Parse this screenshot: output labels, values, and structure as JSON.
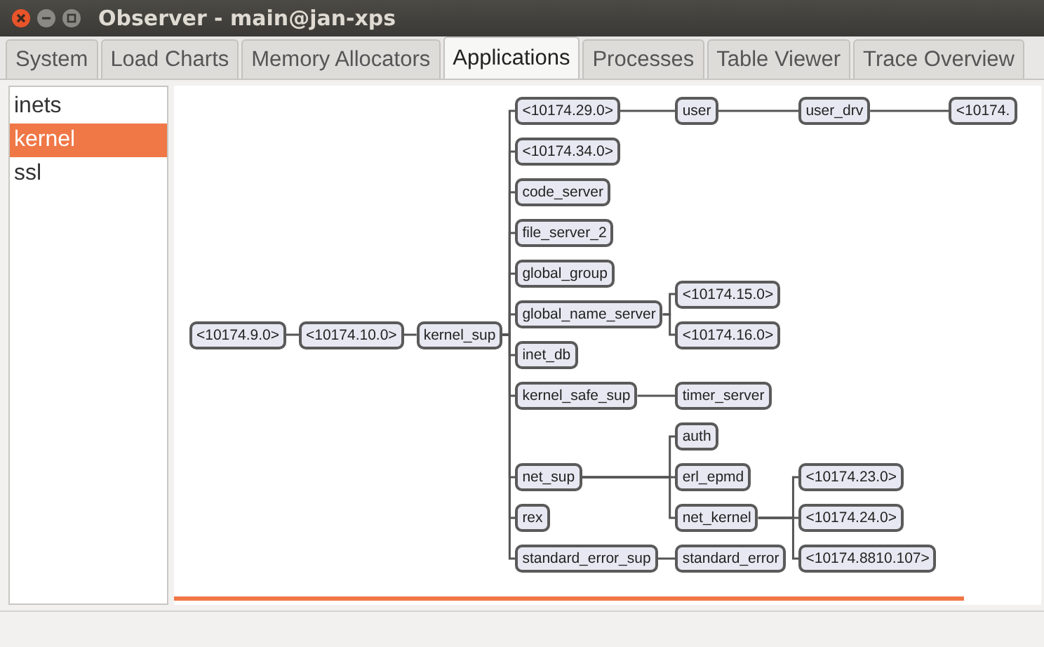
{
  "window": {
    "title": "Observer - main@jan-xps"
  },
  "tabs": [
    {
      "label": "System",
      "selected": false
    },
    {
      "label": "Load Charts",
      "selected": false
    },
    {
      "label": "Memory Allocators",
      "selected": false
    },
    {
      "label": "Applications",
      "selected": true
    },
    {
      "label": "Processes",
      "selected": false
    },
    {
      "label": "Table Viewer",
      "selected": false
    },
    {
      "label": "Trace Overview",
      "selected": false
    }
  ],
  "applications": [
    {
      "label": "inets",
      "selected": false
    },
    {
      "label": "kernel",
      "selected": true
    },
    {
      "label": "ssl",
      "selected": false
    }
  ],
  "tree": {
    "label": "<10174.9.0>",
    "children": [
      {
        "label": "<10174.10.0>",
        "children": [
          {
            "label": "kernel_sup",
            "children": [
              {
                "label": "<10174.29.0>",
                "children": [
                  {
                    "label": "user",
                    "children": [
                      {
                        "label": "user_drv",
                        "children": [
                          {
                            "label": "<10174."
                          }
                        ]
                      }
                    ]
                  }
                ]
              },
              {
                "label": "<10174.34.0>"
              },
              {
                "label": "code_server"
              },
              {
                "label": "file_server_2"
              },
              {
                "label": "global_group"
              },
              {
                "label": "global_name_server",
                "children": [
                  {
                    "label": "<10174.15.0>"
                  },
                  {
                    "label": "<10174.16.0>"
                  }
                ]
              },
              {
                "label": "inet_db"
              },
              {
                "label": "kernel_safe_sup",
                "children": [
                  {
                    "label": "timer_server"
                  }
                ]
              },
              {
                "label": "net_sup",
                "children": [
                  {
                    "label": "auth"
                  },
                  {
                    "label": "erl_epmd"
                  },
                  {
                    "label": "net_kernel",
                    "children": [
                      {
                        "label": "<10174.23.0>"
                      },
                      {
                        "label": "<10174.24.0>"
                      },
                      {
                        "label": "<10174.8810.107>"
                      }
                    ]
                  }
                ]
              },
              {
                "label": "rex"
              },
              {
                "label": "standard_error_sup",
                "children": [
                  {
                    "label": "standard_error"
                  }
                ]
              }
            ]
          }
        ]
      }
    ]
  }
}
